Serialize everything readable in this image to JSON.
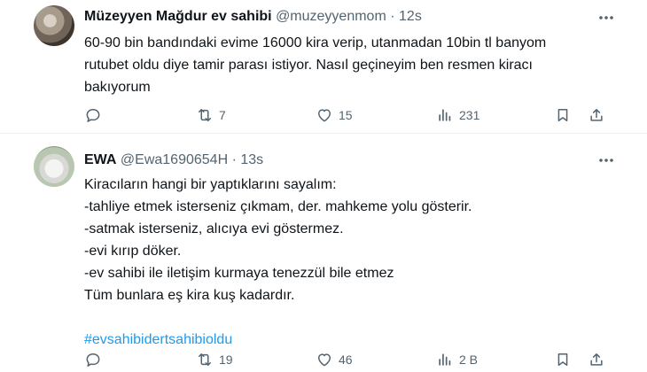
{
  "tweets": [
    {
      "name": "Müzeyyen Mağdur ev sahibi",
      "handle": "@muzeyyenmom",
      "time": "12s",
      "lines": [
        "60-90 bin bandındaki evime 16000 kira verip, utanmadan 10bin tl banyom",
        "rutubet oldu diye tamir parası istiyor.  Nasıl geçineyim ben resmen kiracı",
        "bakıyorum"
      ],
      "actions": {
        "replies": "",
        "retweets": "7",
        "likes": "15",
        "views": "231"
      }
    },
    {
      "name": "EWA",
      "handle": "@Ewa1690654H",
      "time": "13s",
      "lines": [
        "Kiracıların hangi bir yaptıklarını sayalım:",
        "-tahliye etmek isterseniz çıkmam, der. mahkeme yolu gösterir.",
        "-satmak isterseniz, alıcıya evi göstermez.",
        "-evi kırıp döker.",
        "-ev sahibi ile iletişim kurmaya tenezzül bile etmez",
        "Tüm bunlara eş kira kuş kadardır."
      ],
      "hashtag": "#evsahibidertsahibioldu",
      "actions": {
        "replies": "",
        "retweets": "19",
        "likes": "46",
        "views": "2 B"
      }
    }
  ],
  "separator": "·",
  "icons": [
    "avatar",
    "more-icon",
    "reply-icon",
    "retweet-icon",
    "like-icon",
    "views-icon",
    "bookmark-icon",
    "share-icon"
  ]
}
